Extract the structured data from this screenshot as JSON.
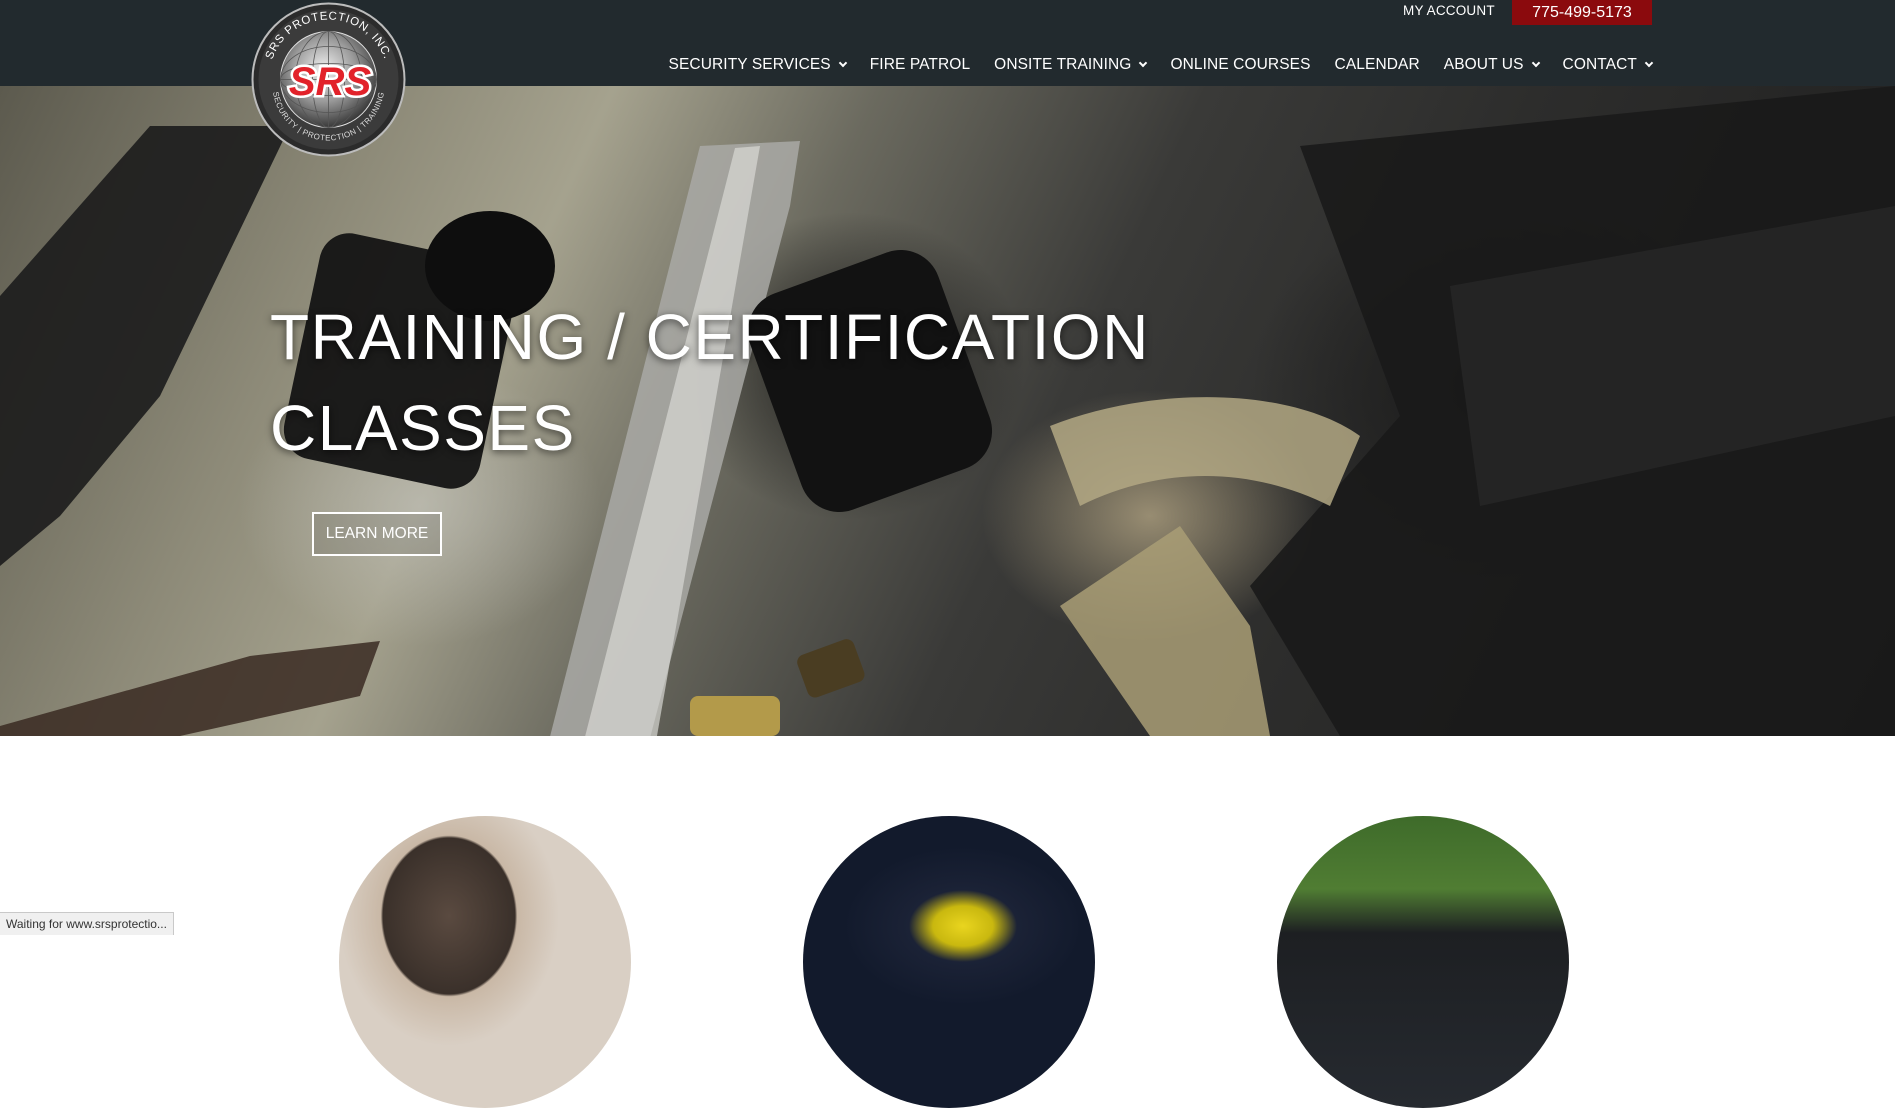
{
  "header": {
    "account_label": "MY ACCOUNT",
    "phone": "775-499-5173",
    "logo": {
      "top_text": "SRS PROTECTION, INC.",
      "mark": "SRS",
      "bottom_text": "SECURITY | PROTECTION | TRAINING"
    },
    "nav": [
      {
        "label": "SECURITY SERVICES",
        "dropdown": true
      },
      {
        "label": "FIRE PATROL",
        "dropdown": false
      },
      {
        "label": "ONSITE TRAINING",
        "dropdown": true
      },
      {
        "label": "ONLINE COURSES",
        "dropdown": false
      },
      {
        "label": "CALENDAR",
        "dropdown": false
      },
      {
        "label": "ABOUT US",
        "dropdown": true
      },
      {
        "label": "CONTACT",
        "dropdown": true
      }
    ]
  },
  "hero": {
    "title_line1": "TRAINING / CERTIFICATION",
    "title_line2": "CLASSES",
    "button_label": "LEARN MORE"
  },
  "status_bar": {
    "text": "Waiting for www.srsprotectio..."
  },
  "colors": {
    "header_bg": "#222a2e",
    "phone_bg": "#8b0a0d",
    "logo_red": "#e2222a"
  }
}
